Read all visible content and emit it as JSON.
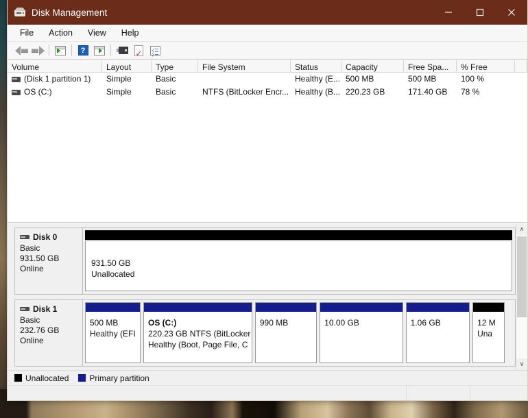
{
  "window": {
    "title": "Disk Management",
    "app_icon": "disk-drive-icon",
    "controls": {
      "minimize": "—",
      "maximize": "□",
      "close": "✕"
    },
    "titlebar_color": "#6b2d1a"
  },
  "menubar": {
    "items": [
      {
        "label": "File"
      },
      {
        "label": "Action"
      },
      {
        "label": "View"
      },
      {
        "label": "Help"
      }
    ]
  },
  "toolbar": {
    "items": [
      {
        "name": "back-arrow-icon",
        "label": "Back"
      },
      {
        "name": "forward-arrow-icon",
        "label": "Forward"
      },
      {
        "name": "show-hide-console-tree-icon",
        "label": "Show/Hide Console Tree"
      },
      {
        "name": "help-icon",
        "label": "Help",
        "glyph": "?"
      },
      {
        "name": "properties-window-icon",
        "label": "Properties"
      },
      {
        "name": "drive-icon",
        "label": "Rescan Disks"
      },
      {
        "name": "checked-document-icon",
        "label": "Properties"
      },
      {
        "name": "task-list-icon",
        "label": "Show Task List"
      }
    ]
  },
  "volume_list": {
    "columns": [
      {
        "label": "Volume",
        "width": 138
      },
      {
        "label": "Layout",
        "width": 72
      },
      {
        "label": "Type",
        "width": 68
      },
      {
        "label": "File System",
        "width": 135
      },
      {
        "label": "Status",
        "width": 74
      },
      {
        "label": "Capacity",
        "width": 91
      },
      {
        "label": "Free Spa...",
        "width": 77
      },
      {
        "label": "% Free",
        "width": 85
      },
      {
        "label": "",
        "width": 30
      }
    ],
    "rows": [
      {
        "volume": "(Disk 1 partition 1)",
        "layout": "Simple",
        "type": "Basic",
        "file_system": "",
        "status": "Healthy (E...",
        "capacity": "500 MB",
        "free_space": "500 MB",
        "percent_free": "100 %"
      },
      {
        "volume": "OS (C:)",
        "layout": "Simple",
        "type": "Basic",
        "file_system": "NTFS (BitLocker Encr...",
        "status": "Healthy (B...",
        "capacity": "220.23 GB",
        "free_space": "171.40 GB",
        "percent_free": "78 %"
      }
    ]
  },
  "graphical_view": {
    "disks": [
      {
        "name": "Disk 0",
        "type": "Basic",
        "size": "931.50 GB",
        "status": "Online",
        "layout": "single",
        "partitions": [
          {
            "kind": "unallocated",
            "cap_color": "#000000",
            "line1": "931.50 GB",
            "line2": "Unallocated",
            "title": "",
            "width_pct": 100
          }
        ]
      },
      {
        "name": "Disk 1",
        "type": "Basic",
        "size": "232.76 GB",
        "status": "Online",
        "layout": "multi",
        "partitions": [
          {
            "kind": "primary",
            "cap_color": "#151c8c",
            "title": "",
            "line1": "500 MB",
            "line2": "Healthy (EFI",
            "width_pct": 13.0
          },
          {
            "kind": "primary",
            "cap_color": "#151c8c",
            "title": "OS  (C:)",
            "line1": "220.23 GB NTFS (BitLocker",
            "line2": "Healthy (Boot, Page File, C",
            "width_pct": 25.5
          },
          {
            "kind": "primary",
            "cap_color": "#151c8c",
            "title": "",
            "line1": "990 MB",
            "line2": "",
            "width_pct": 14.5
          },
          {
            "kind": "primary",
            "cap_color": "#151c8c",
            "title": "",
            "line1": "10.00 GB",
            "line2": "",
            "width_pct": 19.5
          },
          {
            "kind": "primary",
            "cap_color": "#151c8c",
            "title": "",
            "line1": "1.06 GB",
            "line2": "",
            "width_pct": 15.0
          },
          {
            "kind": "unallocated",
            "cap_color": "#000000",
            "title": "",
            "line1": "12 M",
            "line2": "Una",
            "width_pct": 7.5
          }
        ]
      }
    ],
    "scrollbar": {
      "up_glyph": "∧",
      "down_glyph": "∨"
    }
  },
  "legend": {
    "items": [
      {
        "label": "Unallocated",
        "color": "#000000"
      },
      {
        "label": "Primary partition",
        "color": "#151c8c"
      }
    ]
  },
  "statusbar": {
    "text": ""
  }
}
